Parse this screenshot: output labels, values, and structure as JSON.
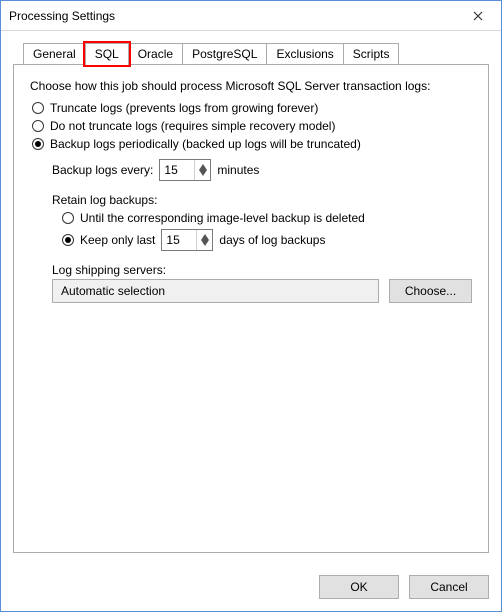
{
  "window": {
    "title": "Processing Settings"
  },
  "tabs": {
    "general": "General",
    "sql": "SQL",
    "oracle": "Oracle",
    "postgresql": "PostgreSQL",
    "exclusions": "Exclusions",
    "scripts": "Scripts"
  },
  "main": {
    "instructions": "Choose how this job should process Microsoft SQL Server transaction logs:",
    "opt_truncate": "Truncate logs (prevents logs from growing forever)",
    "opt_no_truncate": "Do not truncate logs (requires simple recovery model)",
    "opt_backup": "Backup logs periodically (backed up logs will be truncated)",
    "backup_every_label": "Backup logs every:",
    "backup_every_value": "15",
    "backup_every_unit": "minutes",
    "retain_label": "Retain log backups:",
    "retain_until_deleted": "Until the corresponding image-level backup is deleted",
    "retain_keep_only_label": "Keep only last",
    "retain_keep_only_value": "15",
    "retain_keep_only_unit": "days of log backups",
    "log_shipping_label": "Log shipping servers:",
    "log_shipping_value": "Automatic selection",
    "choose_btn": "Choose..."
  },
  "footer": {
    "ok": "OK",
    "cancel": "Cancel"
  }
}
